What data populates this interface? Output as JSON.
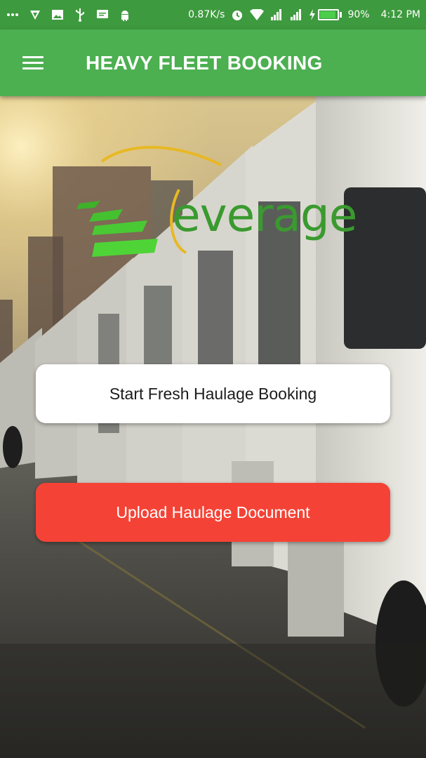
{
  "status_bar": {
    "network_speed": "0.87K/s",
    "battery_percent_text": "90%",
    "battery_level": 0.9,
    "time": "4:12 PM",
    "left_icons": [
      "more-icon",
      "vpn-icon",
      "image-icon",
      "usb-icon",
      "message-icon",
      "android-icon"
    ],
    "right_icons": [
      "alarm-icon",
      "wifi-icon",
      "signal-icon",
      "signal-icon",
      "charging-icon",
      "battery-icon"
    ]
  },
  "app_bar": {
    "title": "HEAVY FLEET BOOKING",
    "menu_icon": "hamburger-menu-icon",
    "color": "#4caf50"
  },
  "logo": {
    "text": "everage",
    "color": "#3a9a2f"
  },
  "actions": {
    "start_booking_label": "Start Fresh Haulage Booking",
    "upload_document_label": "Upload Haulage Document",
    "upload_color": "#f44336"
  }
}
